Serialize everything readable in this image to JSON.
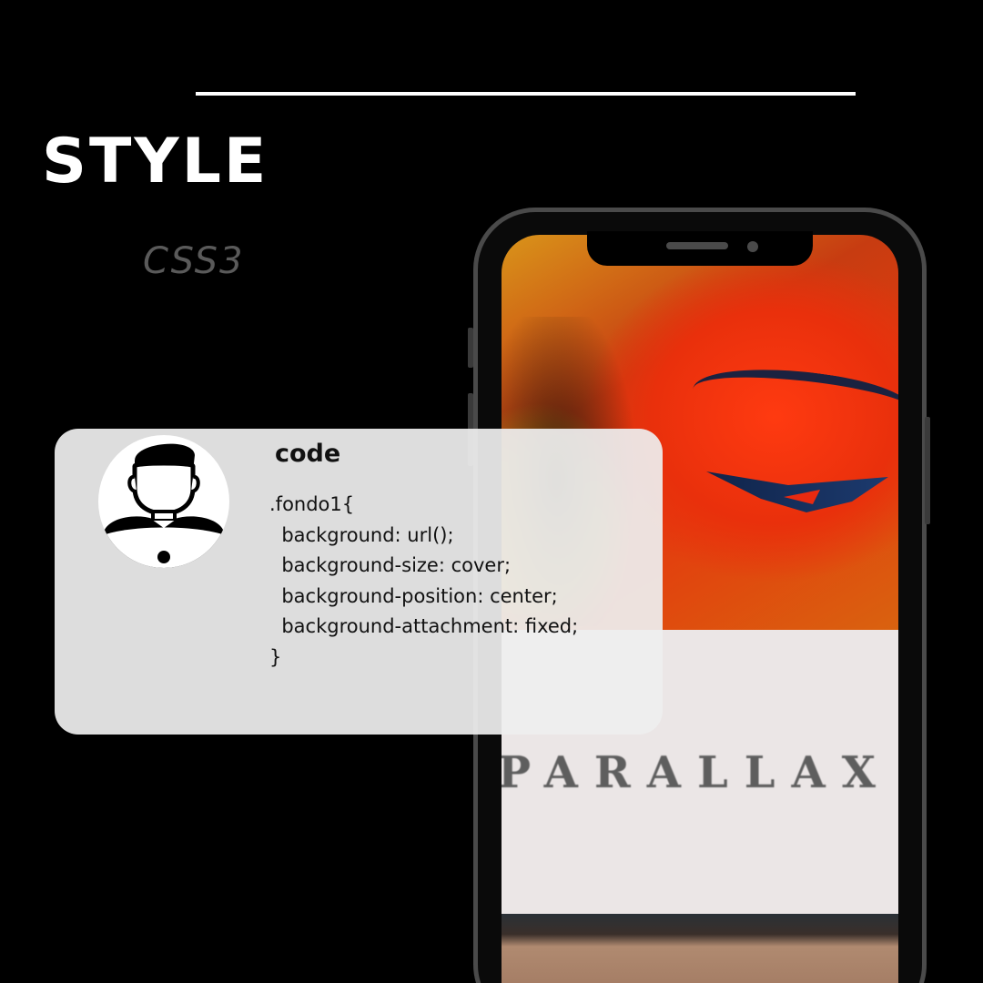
{
  "title": "STYLE",
  "subtitle": "CSS3",
  "card": {
    "heading": "code",
    "code": ".fondo1{\n  background: url();\n  background-size: cover;\n  background-position: center;\n  background-attachment: fixed;\n}"
  },
  "phone": {
    "screen_text": "PARALLAX"
  },
  "colors": {
    "background": "#000000",
    "title": "#ffffff",
    "subtitle": "#5a5a5a",
    "card": "#eeeeee",
    "hero_red": "#e9300c",
    "panel": "#ebe6e6"
  },
  "icons": {
    "avatar": "user-avatar-icon"
  }
}
